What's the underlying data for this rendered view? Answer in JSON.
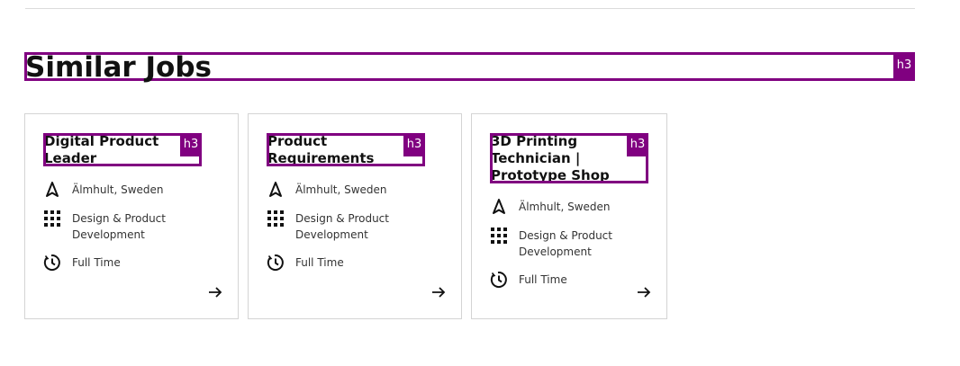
{
  "section": {
    "heading": "Similar Jobs",
    "heading_tag": "h3"
  },
  "jobs": [
    {
      "title": "Digital Product Leader",
      "title_tag": "h3",
      "location": "Älmhult, Sweden",
      "category": "Design & Product Development",
      "employment_type": "Full Time"
    },
    {
      "title": "Product Requirements Engineer",
      "title_tag": "h3",
      "location": "Älmhult, Sweden",
      "category": "Design & Product Development",
      "employment_type": "Full Time"
    },
    {
      "title": "3D Printing Technician | Prototype Shop",
      "title_tag": "h3",
      "location": "Älmhult, Sweden",
      "category": "Design & Product Development",
      "employment_type": "Full Time"
    }
  ],
  "icons": {
    "location": "navigation-arrow-icon",
    "category": "grid-dots-icon",
    "employment_type": "clock-icon",
    "link": "arrow-right-icon"
  },
  "colors": {
    "tag_highlight": "#800080",
    "card_border": "#d4d4d4",
    "text": "#111111"
  }
}
